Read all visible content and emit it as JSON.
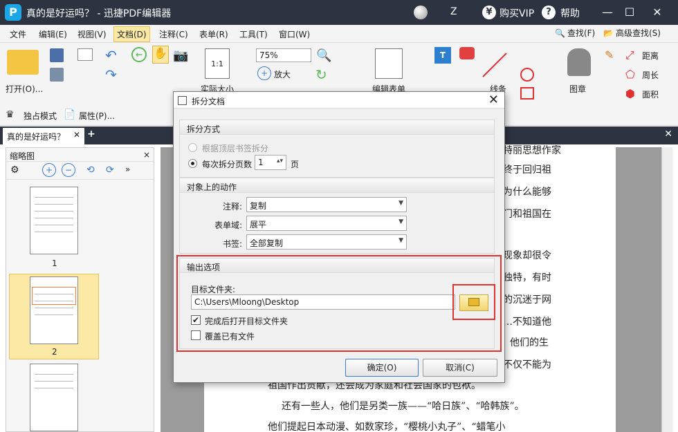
{
  "window": {
    "title": "真的是好运吗？ - 迅捷PDF编辑器",
    "logo": "P",
    "user": "Z",
    "buy_vip": "购买VIP",
    "help": "帮助",
    "yen": "¥",
    "q": "?"
  },
  "menu": [
    "文件",
    "编辑(E)",
    "视图(V)",
    "文档(D)",
    "注释(C)",
    "表单(R)",
    "工具(T)",
    "窗口(W)"
  ],
  "menu_right": {
    "find": "查找(F)",
    "adv_find": "高级查找(S)"
  },
  "ribbon": {
    "open": "打开(O)...",
    "zoom": "75%",
    "zoom_in": "放大",
    "actual_size": "实际大小",
    "edit_form": "编辑表单",
    "lines": "线条",
    "stamp": "图章",
    "distance": "距离",
    "perimeter": "周长",
    "area": "面积",
    "exclusive": "独占模式",
    "properties": "属性(P)..."
  },
  "tabs": {
    "doc": "真的是好运吗？"
  },
  "thumbs": {
    "title": "缩略图",
    "p1": "1",
    "p2": "2"
  },
  "page_text": [
    "特丽思想作家",
    "终于回归祖",
    "为什么能够",
    "门和祖国在",
    "现象却很令",
    "独特，有时",
    "的沉迷于网",
    "…不知道他",
    "他们的生",
    "不仅不能为",
    "祖国作出贡献，还会成为家庭和社会国家的包袱。",
    "还有一些人，他们是另类一族——“哈日族”、“哈韩族”。",
    "他们提起日本动漫、如数家珍，“樱桃小丸子”、“蜡笔小"
  ],
  "dialog": {
    "title": "拆分文档",
    "split": {
      "head": "拆分方式",
      "opt1": "根据顶层书签拆分",
      "opt2": "每次拆分页数",
      "pages": "1",
      "unit": "页"
    },
    "actions": {
      "head": "对象上的动作",
      "annot_label": "注释:",
      "annot_val": "复制",
      "form_label": "表单域:",
      "form_val": "展平",
      "bm_label": "书签:",
      "bm_val": "全部复制"
    },
    "output": {
      "head": "输出选项",
      "target_label": "目标文件夹:",
      "path": "C:\\Users\\Mloong\\Desktop",
      "open_after": "完成后打开目标文件夹",
      "overwrite": "覆盖已有文件"
    },
    "ok": "确定(O)",
    "cancel": "取消(C)"
  },
  "colors": {
    "titlebar": "#2d3340",
    "highlight": "#e03030",
    "accent": "#fde9a6"
  }
}
